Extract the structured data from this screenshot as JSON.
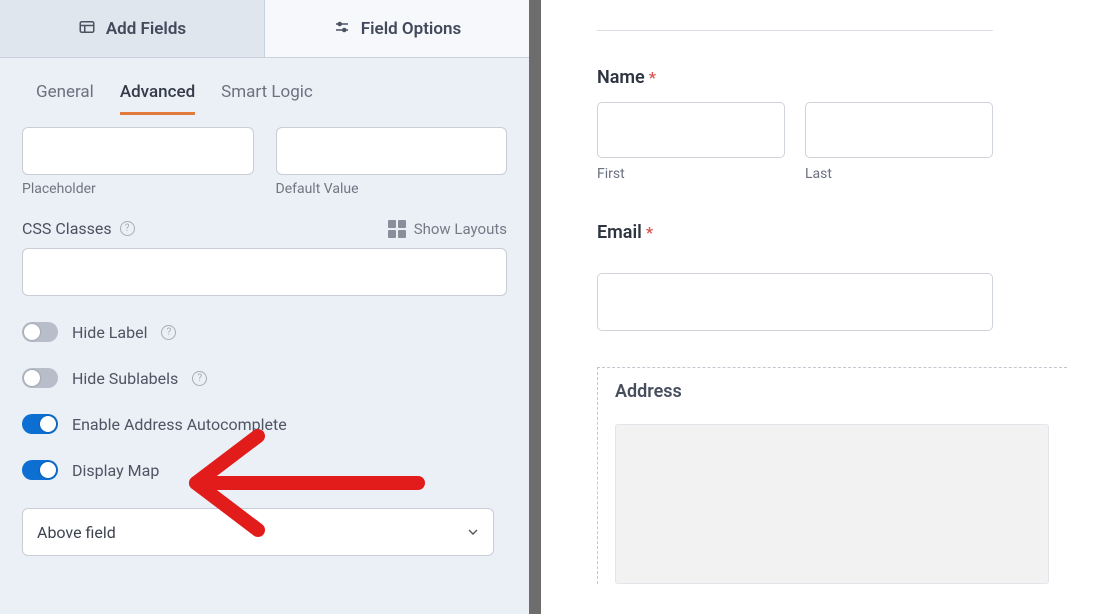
{
  "toptabs": {
    "add_fields": "Add Fields",
    "field_options": "Field Options"
  },
  "subtabs": {
    "general": "General",
    "advanced": "Advanced",
    "smart_logic": "Smart Logic"
  },
  "panel": {
    "placeholder_label": "Placeholder",
    "default_value_label": "Default Value",
    "css_classes_label": "CSS Classes",
    "show_layouts": "Show Layouts",
    "toggles": {
      "hide_label": "Hide Label",
      "hide_sublabels": "Hide Sublabels",
      "enable_autocomplete": "Enable Address Autocomplete",
      "display_map": "Display Map"
    },
    "map_position_select": "Above field"
  },
  "preview": {
    "name_label": "Name",
    "first": "First",
    "last": "Last",
    "email_label": "Email",
    "address_label": "Address"
  }
}
